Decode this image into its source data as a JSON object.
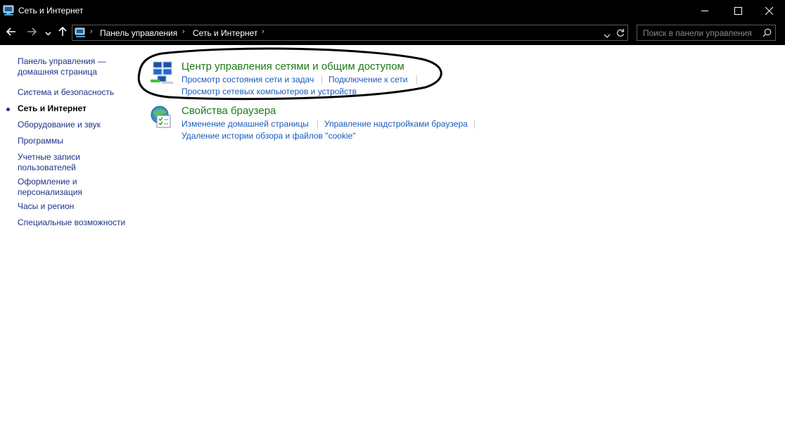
{
  "window": {
    "title": "Сеть и Интернет",
    "minimize_icon": "minimize-icon",
    "maximize_icon": "maximize-icon",
    "close_icon": "close-icon"
  },
  "address_bar": {
    "breadcrumb": [
      "Панель управления",
      "Сеть и Интернет"
    ],
    "search_placeholder": "Поиск в панели управления"
  },
  "left_nav": {
    "home_label": "Панель управления — домашняя страница",
    "items": [
      {
        "label": "Система и безопасность",
        "current": false
      },
      {
        "label": "Сеть и Интернет",
        "current": true
      },
      {
        "label": "Оборудование и звук",
        "current": false
      },
      {
        "label": "Программы",
        "current": false
      },
      {
        "label": "Учетные записи пользователей",
        "current": false
      },
      {
        "label": "Оформление и персонализация",
        "current": false
      },
      {
        "label": "Часы и регион",
        "current": false
      },
      {
        "label": "Специальные возможности",
        "current": false
      }
    ]
  },
  "categories": [
    {
      "title": "Центр управления сетями и общим доступом",
      "icon": "network-center-icon",
      "tasks": [
        "Просмотр состояния сети и задач",
        "Подключение к сети",
        "Просмотр сетевых компьютеров и устройств"
      ]
    },
    {
      "title": "Свойства браузера",
      "icon": "browser-properties-icon",
      "tasks": [
        "Изменение домашней страницы",
        "Управление надстройками браузера",
        "Удаление истории обзора и файлов \"cookie\""
      ]
    }
  ],
  "colors": {
    "chrome_bg": "#000000",
    "link": "#1a5bbd",
    "category_title": "#1e7a19",
    "nav_link": "#1e3287"
  }
}
